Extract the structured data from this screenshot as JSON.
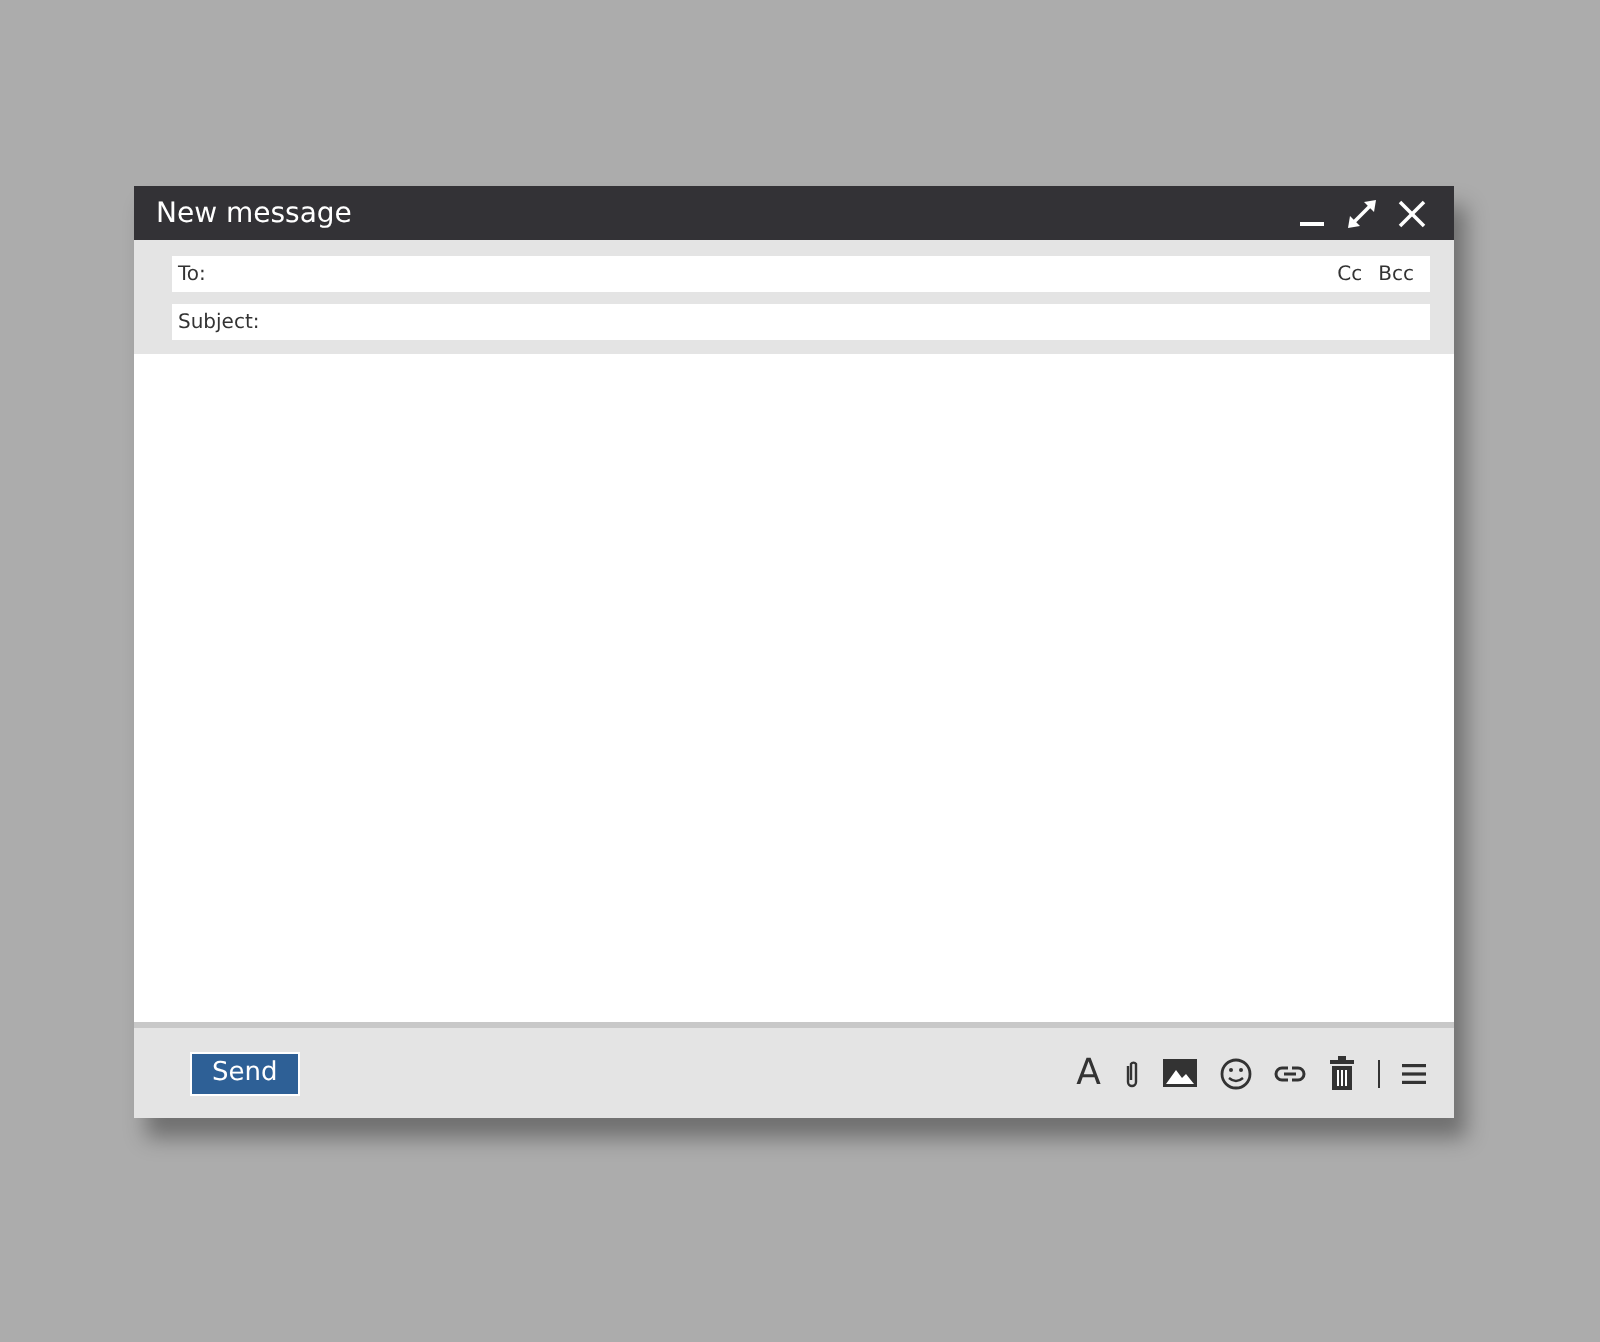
{
  "window": {
    "title": "New message"
  },
  "fields": [
    {
      "kind": "recipients",
      "label": "To:",
      "extras": [
        "Cc",
        "Bcc"
      ]
    },
    {
      "kind": "subject",
      "label": "Subject:"
    }
  ],
  "toolbar": {
    "send": "Send",
    "format": "A"
  }
}
